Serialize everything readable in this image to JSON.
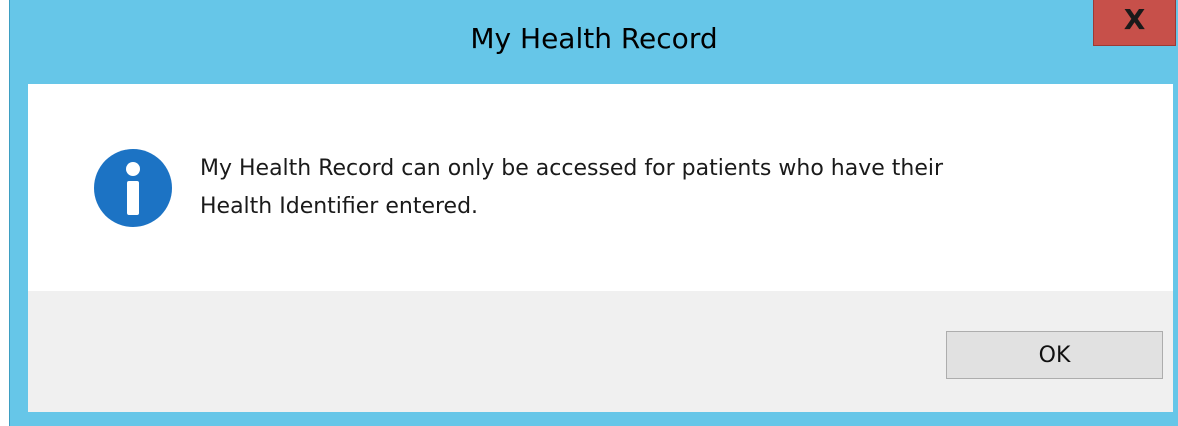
{
  "window": {
    "title": "My Health Record",
    "close_label": "X"
  },
  "message": {
    "icon": "info-icon",
    "line1": "My Health Record can only be accessed for patients who have their",
    "line2": "Health Identifier entered."
  },
  "buttons": {
    "ok_label": "OK"
  },
  "colors": {
    "titlebar": "#66c6e8",
    "close_button": "#c7504a",
    "info_icon": "#1c73c4",
    "footer": "#f0f0f0",
    "button_face": "#e1e1e1"
  }
}
